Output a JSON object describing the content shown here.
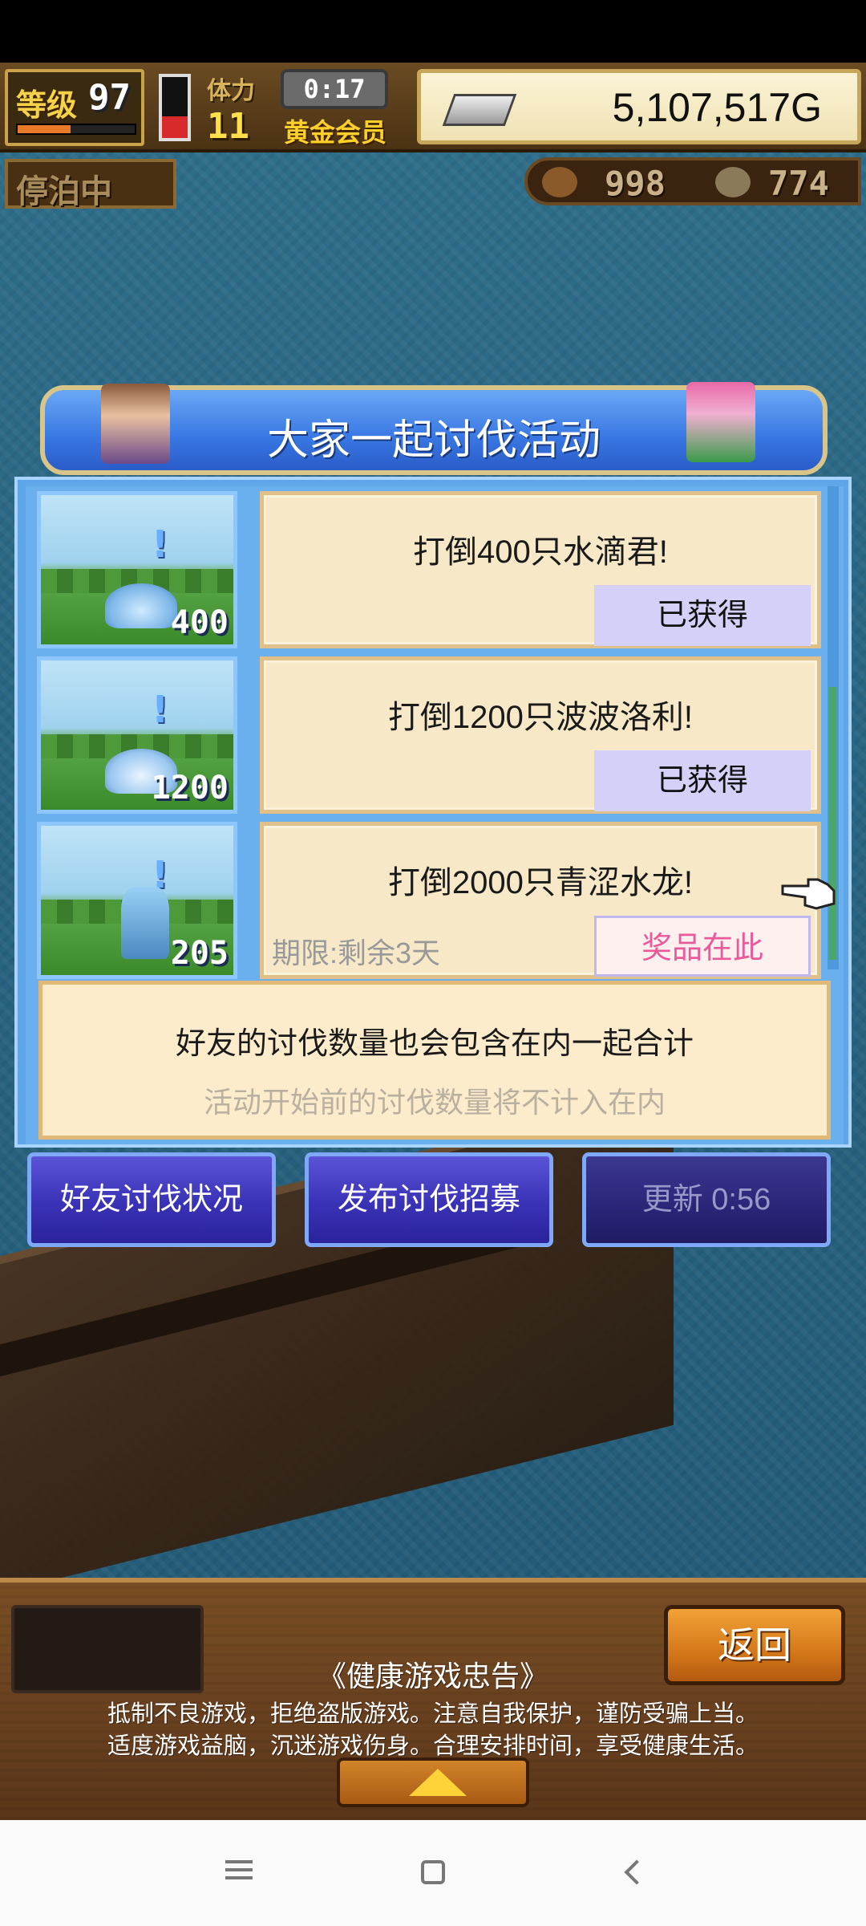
{
  "hud": {
    "level_label": "等级",
    "level_value": "97",
    "level_progress": 0.45,
    "hp_fill": 0.35,
    "stamina_label": "体力",
    "stamina_value": "11",
    "timer": "0:17",
    "membership": "黄金会员",
    "money": "5,107,517G"
  },
  "status": {
    "anchored": "停泊中"
  },
  "resources": {
    "wood": "998",
    "stone": "774"
  },
  "dialog": {
    "title": "大家一起讨伐活动",
    "rows": [
      {
        "count": "400",
        "goal": "打倒400只水滴君!",
        "button": "已获得",
        "state": "claimed"
      },
      {
        "count": "1200",
        "goal": "打倒1200只波波洛利!",
        "button": "已获得",
        "state": "claimed"
      },
      {
        "count": "205",
        "goal": "打倒2000只青涩水龙!",
        "button": "奖品在此",
        "state": "prize",
        "deadline": "期限:剩余3天"
      }
    ],
    "note_line1": "好友的讨伐数量也会包含在内一起合计",
    "note_line2": "活动开始前的讨伐数量将不计入在内",
    "buttons": {
      "friends": "好友讨伐状况",
      "recruit": "发布讨伐招募",
      "refresh": "更新 0:56"
    }
  },
  "footer": {
    "back": "返回",
    "health_title": "《健康游戏忠告》",
    "health_line1": "抵制不良游戏，拒绝盗版游戏。注意自我保护，谨防受骗上当。",
    "health_line2": "适度游戏益脑，沉迷游戏伤身。合理安排时间，享受健康生活。"
  },
  "colors": {
    "dialog_blue": "#3877e3",
    "claimed_button": "#d5d0f8",
    "prize_text": "#e85a9a",
    "card_bg": "#f7e8c8"
  }
}
